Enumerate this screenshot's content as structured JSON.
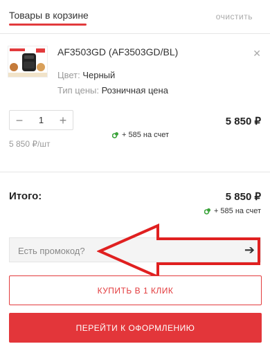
{
  "header": {
    "title": "Товары в корзине",
    "clear_label": "очистить"
  },
  "product": {
    "name": "AF3503GD (AF3503GD/BL)",
    "color_key": "Цвет:",
    "color_value": "Черный",
    "price_type_key": "Тип цены:",
    "price_type_value": "Розничная цена",
    "quantity": "1",
    "line_total": "5 850 ₽",
    "bonus": "+ 585 на счет",
    "unit_price": "5 850 ₽/шт"
  },
  "summary": {
    "total_label": "Итого:",
    "total_price": "5 850 ₽",
    "bonus": "+ 585 на счет"
  },
  "promo": {
    "placeholder": "Есть промокод?"
  },
  "buttons": {
    "one_click": "КУПИТЬ В 1 КЛИК",
    "checkout": "ПЕРЕЙТИ К ОФОРМЛЕНИЮ"
  },
  "colors": {
    "accent": "#e23a3c",
    "bonus_icon": "#3aa33a"
  },
  "icons": {
    "close": "close-icon",
    "minus": "minus-icon",
    "plus": "plus-icon",
    "bonus": "bonus-coins-icon",
    "submit": "arrow-right-icon"
  }
}
